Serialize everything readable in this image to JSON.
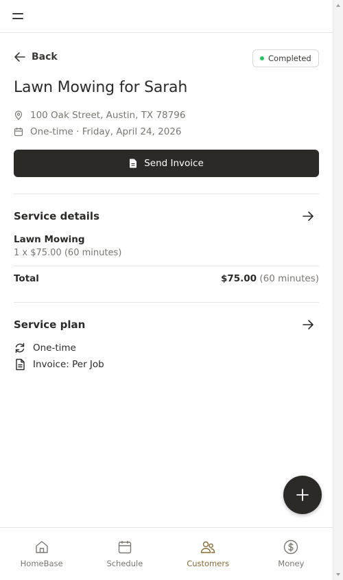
{
  "header": {
    "menu_icon": "hamburger-menu-icon"
  },
  "nav": {
    "back_label": "Back"
  },
  "job": {
    "status": "Completed",
    "status_color": "#22c55e",
    "title": "Lawn Mowing for Sarah",
    "address": "100 Oak Street, Austin, TX 78796",
    "schedule": "One-time · Friday, April 24, 2026"
  },
  "actions": {
    "send_invoice_label": "Send Invoice"
  },
  "service_details": {
    "title": "Service details",
    "item_name": "Lawn Mowing",
    "item_detail": "1 x $75.00 (60 minutes)",
    "total_label": "Total",
    "total_amount": "$75.00",
    "total_duration": "(60 minutes)"
  },
  "service_plan": {
    "title": "Service plan",
    "frequency": "One-time",
    "invoice": "Invoice: Per Job"
  },
  "bottom_nav": {
    "items": [
      {
        "label": "HomeBase",
        "icon": "home-icon"
      },
      {
        "label": "Schedule",
        "icon": "calendar-icon"
      },
      {
        "label": "Customers",
        "icon": "customers-icon"
      },
      {
        "label": "Money",
        "icon": "dollar-circle-icon"
      }
    ],
    "active_color": "#8a6a33"
  },
  "fab": {
    "icon": "plus-icon"
  }
}
